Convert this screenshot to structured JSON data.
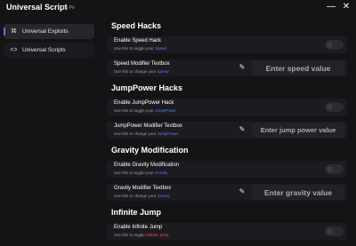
{
  "window": {
    "title": "Universal Script",
    "subtitle": "by Pri",
    "minimize_glyph": "—",
    "close_glyph": "✕"
  },
  "sidebar": {
    "items": [
      {
        "label": "Universal Exploits",
        "icon": "gamepad-icon",
        "glyph": "⌘",
        "active": true
      },
      {
        "label": "Universal Scripts",
        "icon": "code-icon",
        "glyph": "<>",
        "active": false
      }
    ]
  },
  "sections": [
    {
      "title": "Speed Hacks",
      "toggle": {
        "title": "Enable Speed Hack",
        "desc_prefix": "Use this to toggle your",
        "desc_highlight": "Speed",
        "on": false
      },
      "textbox": {
        "title": "Speed Modifier Textbox",
        "desc_prefix": "Use this to change your",
        "desc_highlight": "Speed",
        "placeholder": "Enter speed value",
        "value": ""
      }
    },
    {
      "title": "JumpPower Hacks",
      "toggle": {
        "title": "Enable JumpPower Hack",
        "desc_prefix": "Use this to toggle your",
        "desc_highlight": "JumpPower",
        "on": false
      },
      "textbox": {
        "title": "JumpPower Modifier Textbox",
        "desc_prefix": "Use this to change your",
        "desc_highlight": "JumpPower",
        "placeholder": "Enter jump power value",
        "value": ""
      }
    },
    {
      "title": "Gravity Modification",
      "toggle": {
        "title": "Enable Gravity Modification",
        "desc_prefix": "Use this to toggle your",
        "desc_highlight": "Gravity",
        "on": false
      },
      "textbox": {
        "title": "Gravity Modifier Textbox",
        "desc_prefix": "Use this to change your",
        "desc_highlight": "Gravity",
        "placeholder": "Enter gravity value",
        "value": ""
      }
    },
    {
      "title": "Infinite Jump",
      "toggle": {
        "title": "Enable Infinite Jump",
        "desc_prefix": "Use this to toggle",
        "desc_highlight": "Infinite Jump",
        "on": false
      }
    }
  ],
  "colors": {
    "accent": "#5a78ff",
    "highlight_blue": "#4f7dff",
    "highlight_red": "#ff4a4a",
    "background": "#141416",
    "row_background": "#1c1c20"
  },
  "icons": {
    "pencil": "✎"
  }
}
